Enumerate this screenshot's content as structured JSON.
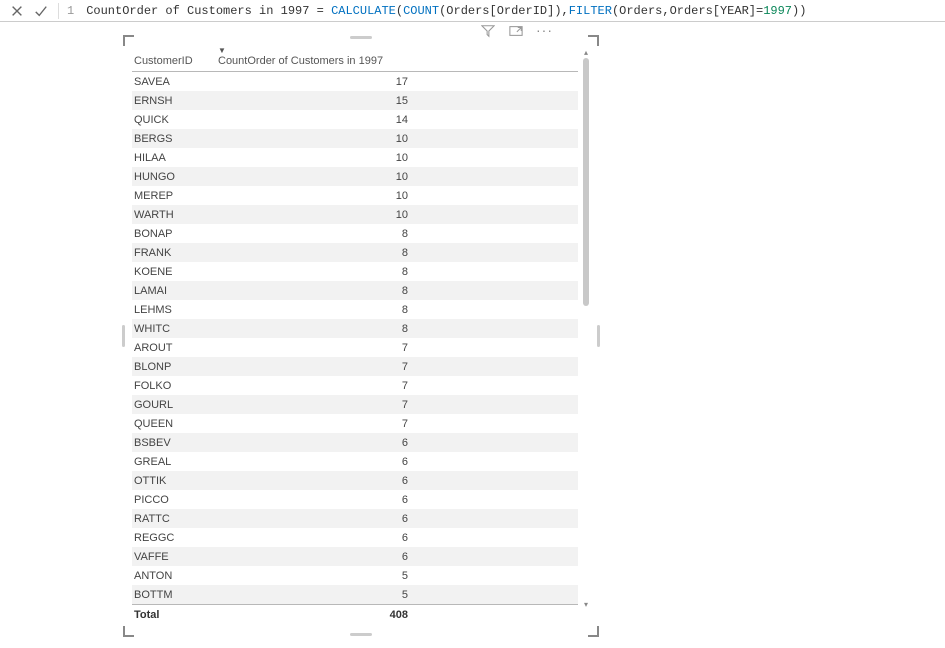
{
  "formula_bar": {
    "line_number": "1",
    "measure_name": "CountOrder of Customers in 1997",
    "eq": " = ",
    "fn_calculate": "CALCULATE",
    "p1": "(",
    "fn_count": "COUNT",
    "p2": "(",
    "arg1": "Orders[OrderID]",
    "p3": "),",
    "fn_filter": "FILTER",
    "p4": "(",
    "arg2": "Orders,Orders[YEAR]=",
    "lit_year": "1997",
    "p5": "))"
  },
  "table": {
    "columns": {
      "col1": "CustomerID",
      "col2": "CountOrder of Customers in 1997"
    },
    "rows": [
      {
        "id": "SAVEA",
        "val": "17"
      },
      {
        "id": "ERNSH",
        "val": "15"
      },
      {
        "id": "QUICK",
        "val": "14"
      },
      {
        "id": "BERGS",
        "val": "10"
      },
      {
        "id": "HILAA",
        "val": "10"
      },
      {
        "id": "HUNGO",
        "val": "10"
      },
      {
        "id": "MEREP",
        "val": "10"
      },
      {
        "id": "WARTH",
        "val": "10"
      },
      {
        "id": "BONAP",
        "val": "8"
      },
      {
        "id": "FRANK",
        "val": "8"
      },
      {
        "id": "KOENE",
        "val": "8"
      },
      {
        "id": "LAMAI",
        "val": "8"
      },
      {
        "id": "LEHMS",
        "val": "8"
      },
      {
        "id": "WHITC",
        "val": "8"
      },
      {
        "id": "AROUT",
        "val": "7"
      },
      {
        "id": "BLONP",
        "val": "7"
      },
      {
        "id": "FOLKO",
        "val": "7"
      },
      {
        "id": "GOURL",
        "val": "7"
      },
      {
        "id": "QUEEN",
        "val": "7"
      },
      {
        "id": "BSBEV",
        "val": "6"
      },
      {
        "id": "GREAL",
        "val": "6"
      },
      {
        "id": "OTTIK",
        "val": "6"
      },
      {
        "id": "PICCO",
        "val": "6"
      },
      {
        "id": "RATTC",
        "val": "6"
      },
      {
        "id": "REGGC",
        "val": "6"
      },
      {
        "id": "VAFFE",
        "val": "6"
      },
      {
        "id": "ANTON",
        "val": "5"
      },
      {
        "id": "BOTTM",
        "val": "5"
      }
    ],
    "footer": {
      "label": "Total",
      "value": "408"
    }
  }
}
